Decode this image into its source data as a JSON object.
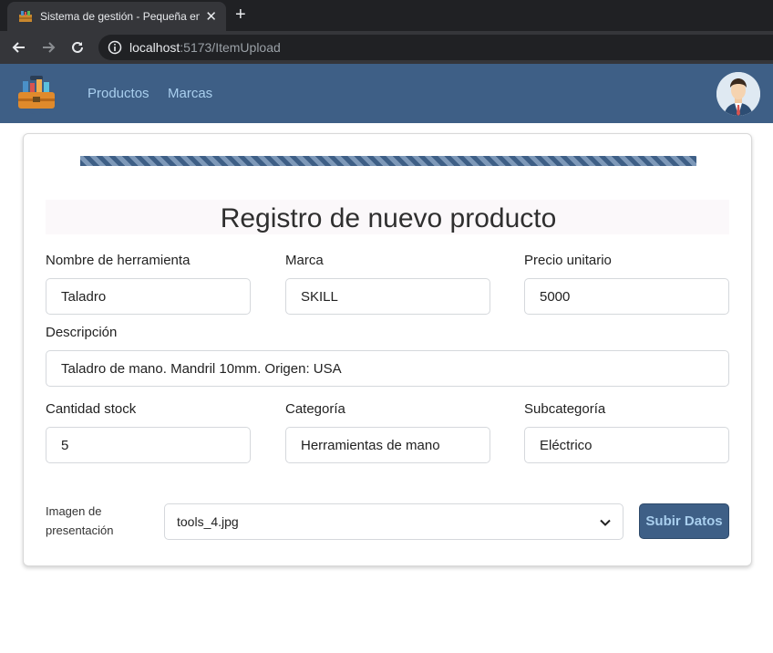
{
  "browser": {
    "tab_title": "Sistema de gestión - Pequeña em",
    "url_host": "localhost",
    "url_rest": ":5173/ItemUpload"
  },
  "nav": {
    "links": [
      "Productos",
      "Marcas"
    ]
  },
  "form": {
    "title": "Registro de nuevo producto",
    "progress_percent": 100,
    "fields": {
      "nombre": {
        "label": "Nombre de herramienta",
        "value": "Taladro"
      },
      "marca": {
        "label": "Marca",
        "value": "SKILL"
      },
      "precio": {
        "label": "Precio unitario",
        "value": "5000"
      },
      "descripcion": {
        "label": "Descripción",
        "value": "Taladro de mano. Mandril 10mm. Origen: USA"
      },
      "stock": {
        "label": "Cantidad stock",
        "value": "5"
      },
      "categoria": {
        "label": "Categoría",
        "value": "Herramientas de mano"
      },
      "subcategoria": {
        "label": "Subcategoría",
        "value": "Eléctrico"
      }
    },
    "image": {
      "label_line1": "Imagen de",
      "label_line2": "presentación",
      "selected": "tools_4.jpg"
    },
    "submit_label": "Subir Datos"
  },
  "colors": {
    "navbar": "#3e5f86",
    "nav_link": "#a9cfee"
  }
}
